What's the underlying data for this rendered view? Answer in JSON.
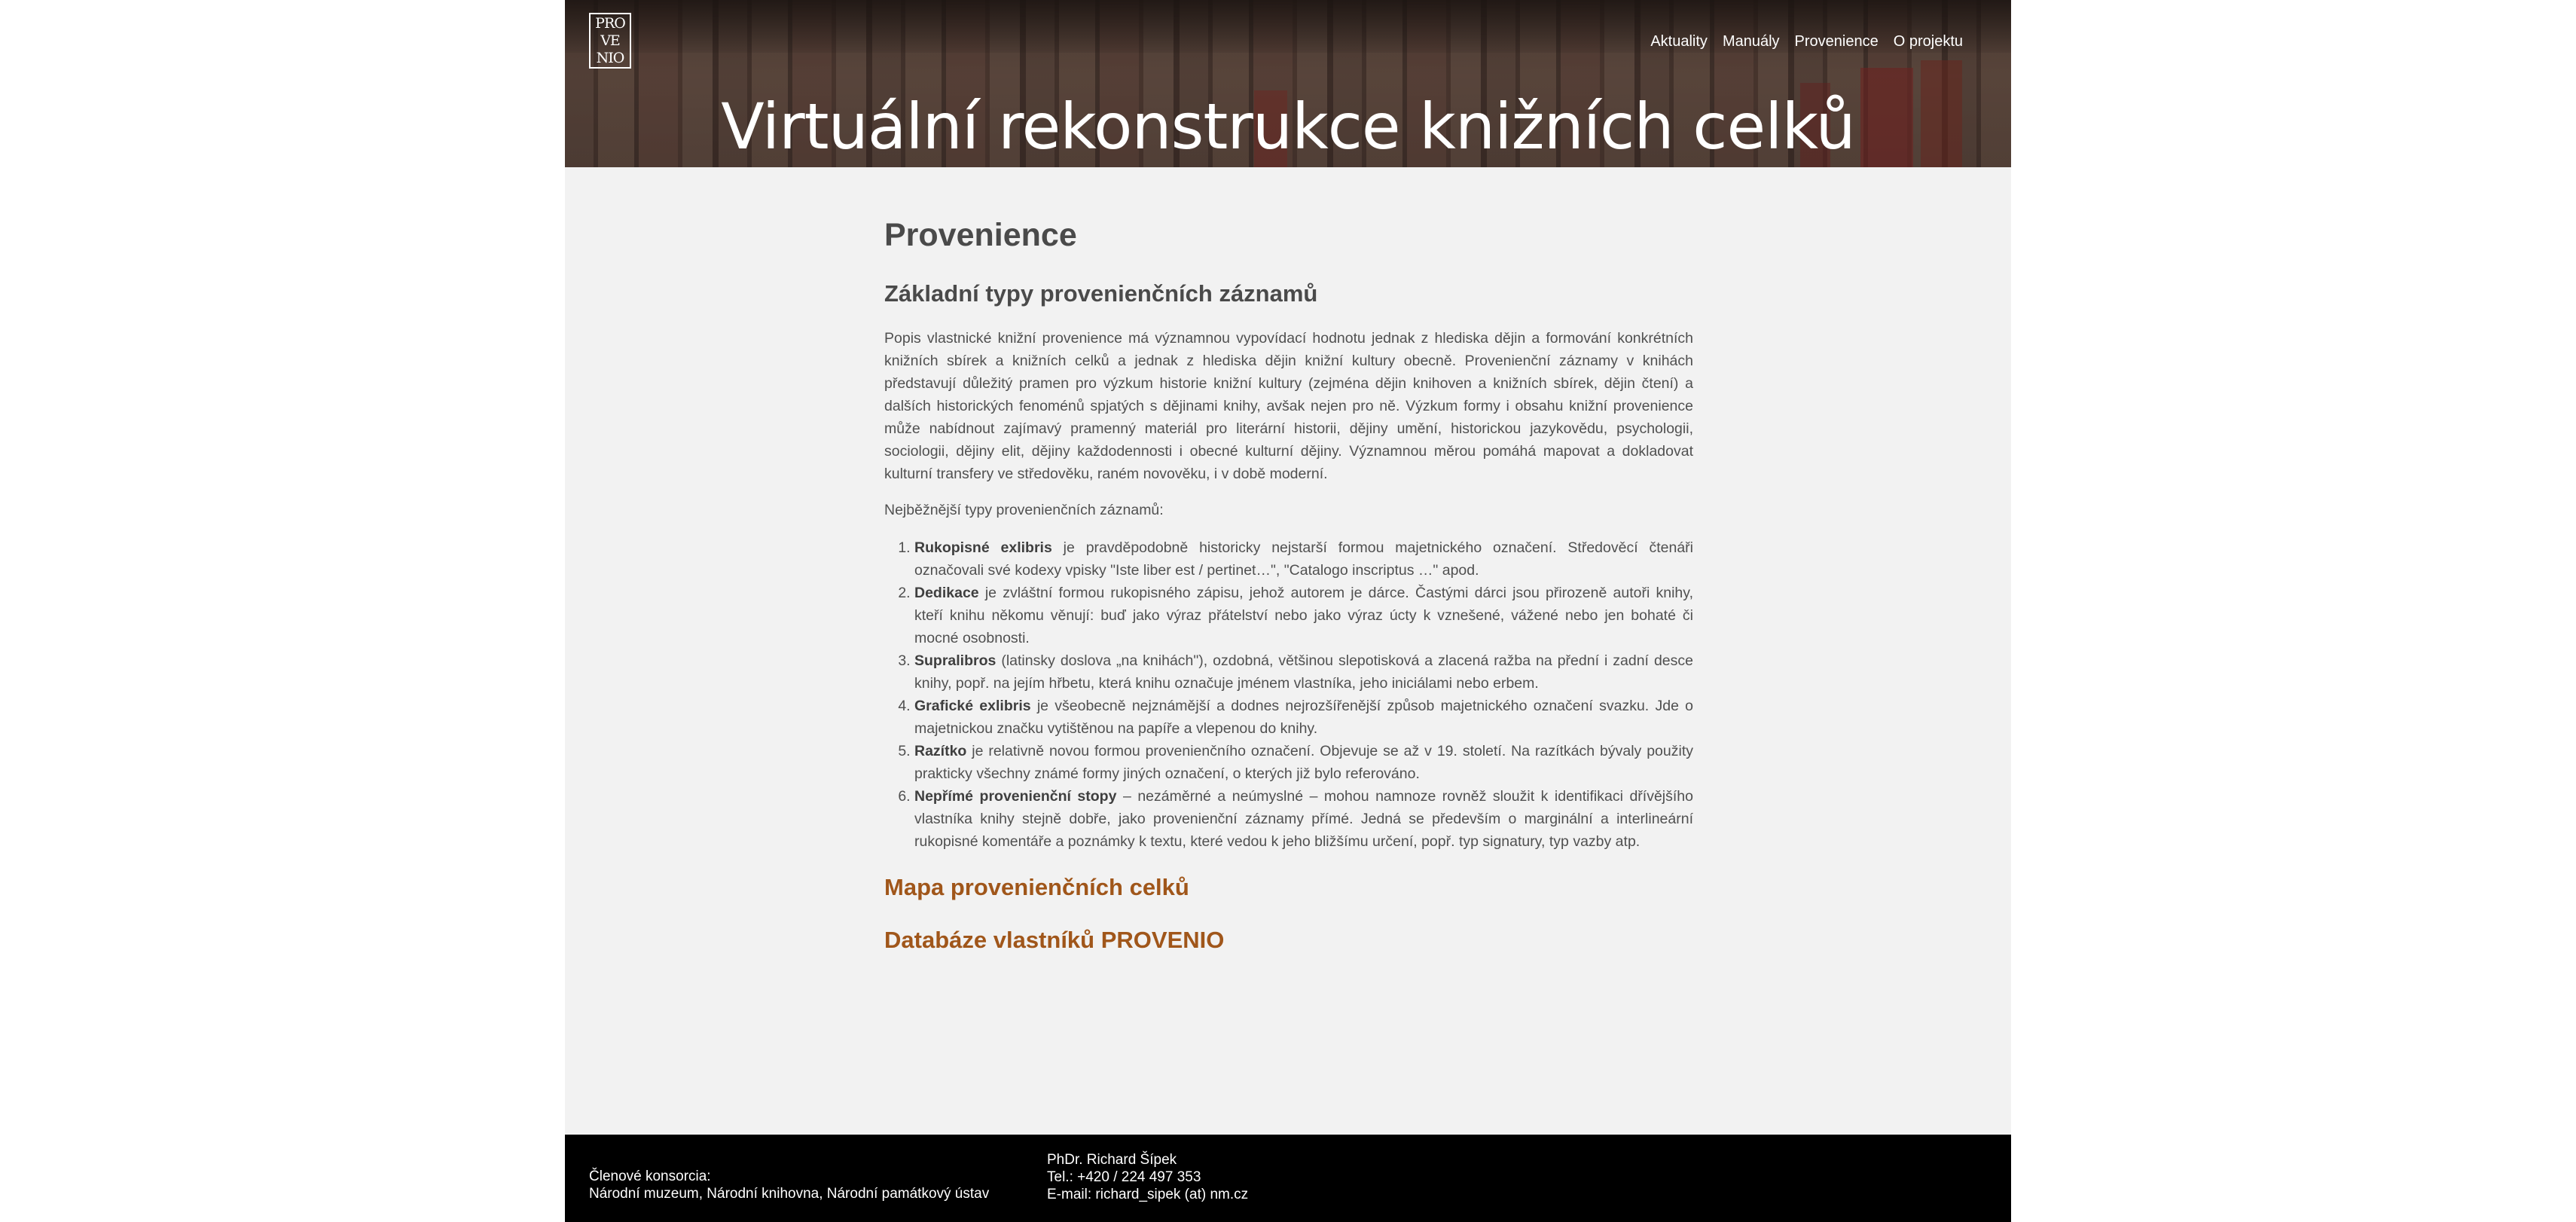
{
  "logo": {
    "lines": [
      "PRO",
      "VE",
      "NIO"
    ]
  },
  "nav": {
    "items": [
      {
        "label": "Aktuality"
      },
      {
        "label": "Manuály"
      },
      {
        "label": "Provenience"
      },
      {
        "label": "O projektu"
      }
    ]
  },
  "hero": {
    "title": "Virtuální rekonstrukce knižních celků"
  },
  "main": {
    "title": "Provenience",
    "section_title": "Základní typy provenienčních záznamů",
    "intro": "Popis vlastnické knižní provenience má významnou vypovídací hodnotu jednak z hlediska dějin a formování konkrétních knižních sbírek a knižních celků a jednak z hlediska dějin knižní kultury obecně. Provenienční záznamy v knihách představují důležitý pramen pro výzkum historie knižní kultury (zejména dějin knihoven a knižních sbírek, dějin čtení) a dalších historických fenoménů spjatých s dějinami knihy, avšak nejen pro ně. Výzkum formy i obsahu knižní provenience může nabídnout zajímavý pramenný materiál pro literární historii, dějiny umění, historickou jazykovědu, psychologii, sociologii, dějiny elit, dějiny každodennosti i obecné kulturní dějiny. Významnou měrou pomáhá mapovat a dokladovat kulturní transfery ve středověku, raném novověku, i v době moderní.",
    "list_lead": "Nejběžnější typy provenienčních záznamů:",
    "types": [
      {
        "term": "Rukopisné exlibris",
        "text": " je pravděpodobně historicky nejstarší formou majetnického označení. Středověcí čtenáři označovali své kodexy vpisky \"Iste liber est / pertinet…\", \"Catalogo inscriptus …\" apod."
      },
      {
        "term": "Dedikace",
        "text": " je zvláštní formou rukopisného zápisu, jehož autorem je dárce. Častými dárci jsou přirozeně autoři knihy, kteří knihu někomu věnují: buď jako výraz přátelství nebo jako výraz úcty k vznešené, vážené nebo jen bohaté či mocné osobnosti."
      },
      {
        "term": "Supralibros",
        "text": " (latinsky doslova „na knihách\"), ozdobná, většinou slepotisková a zlacená ražba na přední i zadní desce knihy, popř. na jejím hřbetu, která knihu označuje jménem vlastníka, jeho iniciálami nebo erbem."
      },
      {
        "term": "Grafické exlibris",
        "text": " je všeobecně nejznámější a dodnes nejrozšířenější způsob majetnického označení svazku. Jde o majetnickou značku vytištěnou na papíře a vlepenou do knihy."
      },
      {
        "term": "Razítko",
        "text": " je relativně novou formou provenienčního označení. Objevuje se až v 19. století. Na razítkách bývaly použity prakticky všechny známé formy jiných označení, o kterých již bylo referováno."
      },
      {
        "term": "Nepřímé provenienční stopy",
        "text": " – nezáměrné a neúmyslné – mohou namnoze rovněž sloužit k identifikaci dřívějšího vlastníka knihy stejně dobře, jako provenienční záznamy přímé. Jedná se především o marginální a interlineární rukopisné komentáře a poznámky k textu, které vedou k jeho bližšímu určení, popř. typ signatury, typ vazby atp."
      }
    ],
    "link_map": "Mapa provenienčních celků",
    "link_db": "Databáze vlastníků PROVENIO"
  },
  "footer": {
    "left": [
      "Členové konsorcia:",
      "Národní muzeum, Národní knihovna, Národní památkový ústav"
    ],
    "right": [
      "PhDr. Richard Šípek",
      "Tel.: +420 / 224 497 353",
      "E-mail: richard_sipek (at) nm.cz"
    ]
  },
  "colors": {
    "link": "#a0561a",
    "background": "#f2f2f2",
    "footer_bg": "#000000",
    "text": "#505050"
  }
}
